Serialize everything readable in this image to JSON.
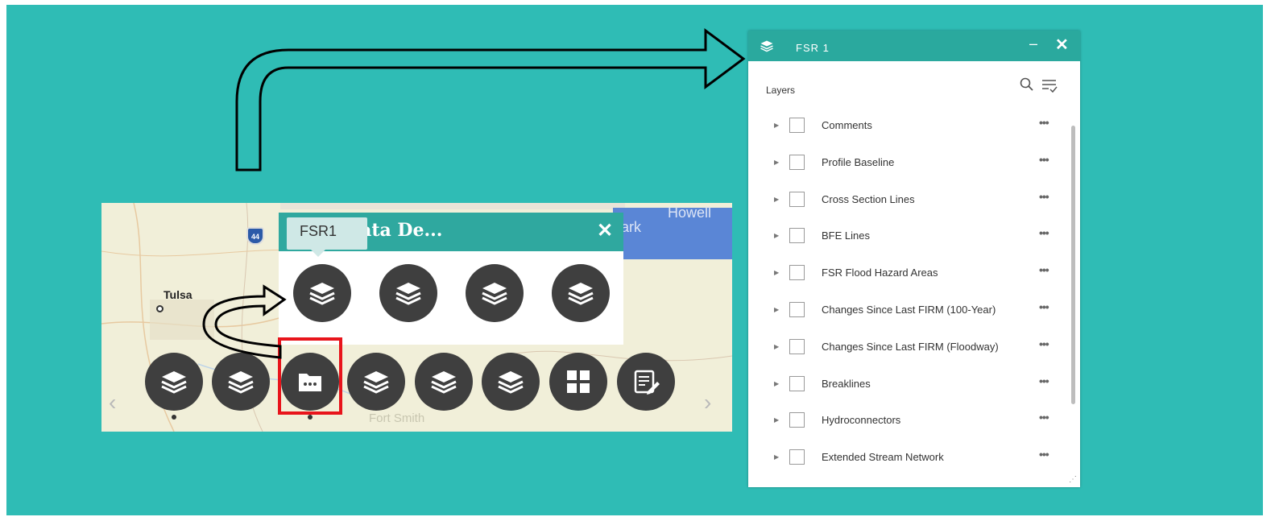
{
  "map": {
    "labels": {
      "tulsa": "Tulsa",
      "fort_smith": "Fort Smith",
      "howell": "Howell",
      "ark": "ark",
      "interstate": "44"
    }
  },
  "group_panel": {
    "title": "Data De...",
    "tooltip": "FSR1",
    "close_glyph": "✕",
    "icons": [
      "layers-icon",
      "layers-icon",
      "layers-icon",
      "layers-icon"
    ]
  },
  "toolbar": {
    "prev_glyph": "‹",
    "next_glyph": "›",
    "buttons": [
      "layers-icon",
      "layers-icon",
      "folder-more-icon",
      "layers-icon",
      "layers-icon",
      "layers-icon",
      "grid-icon",
      "edit-doc-icon"
    ],
    "highlighted_index": 2,
    "active_dots": [
      0,
      2
    ]
  },
  "layer_panel": {
    "title": "FSR 1",
    "minimize_glyph": "–",
    "close_glyph": "✕",
    "section_label": "Layers",
    "more_glyph": "•••",
    "caret_glyph": "▶",
    "layers": [
      "Comments",
      "Profile Baseline",
      "Cross Section Lines",
      "BFE Lines",
      "FSR Flood Hazard Areas",
      "Changes Since Last FIRM (100-Year)",
      "Changes Since Last FIRM (Floodway)",
      "Breaklines",
      "Hydroconnectors",
      "Extended Stream Network"
    ]
  },
  "colors": {
    "background": "#2fbcb5",
    "header_teal": "#2aa99e",
    "highlight_red": "#e8141b",
    "button_dark": "#3f3f3f"
  }
}
